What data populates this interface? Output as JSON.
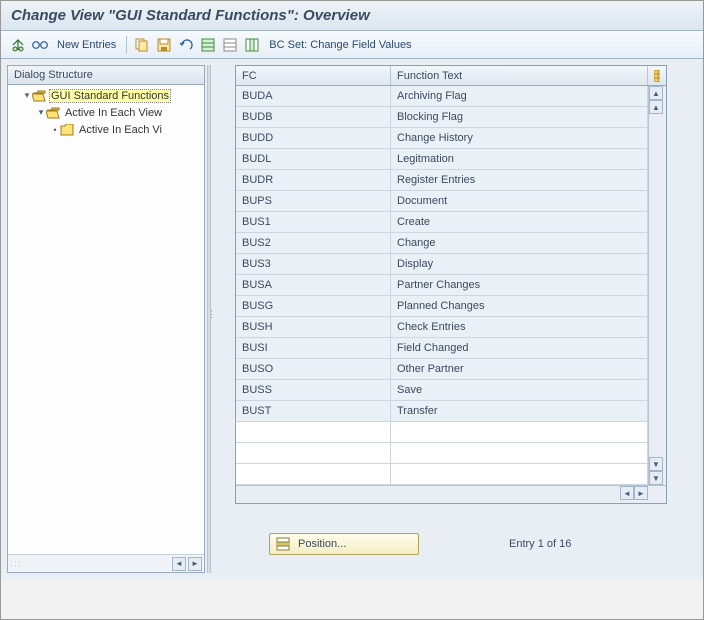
{
  "title": "Change View \"GUI Standard Functions\": Overview",
  "toolbar": {
    "new_entries": "New Entries",
    "bc_set": "BC Set: Change Field Values"
  },
  "tree": {
    "header": "Dialog Structure",
    "nodes": [
      {
        "label": "GUI Standard Functions",
        "indent": 1,
        "toggle": "▾",
        "open": true,
        "selected": true
      },
      {
        "label": "Active In Each View",
        "indent": 2,
        "toggle": "▾",
        "open": true,
        "selected": false
      },
      {
        "label": "Active In Each Vi",
        "indent": 3,
        "toggle": "•",
        "open": false,
        "selected": false
      }
    ]
  },
  "table": {
    "col_fc": "FC",
    "col_ft": "Function Text",
    "rows": [
      {
        "fc": "BUDA",
        "ft": "Archiving Flag"
      },
      {
        "fc": "BUDB",
        "ft": "Blocking Flag"
      },
      {
        "fc": "BUDD",
        "ft": "Change History"
      },
      {
        "fc": "BUDL",
        "ft": "Legitmation"
      },
      {
        "fc": "BUDR",
        "ft": "Register Entries"
      },
      {
        "fc": "BUPS",
        "ft": "Document"
      },
      {
        "fc": "BUS1",
        "ft": "Create"
      },
      {
        "fc": "BUS2",
        "ft": "Change"
      },
      {
        "fc": "BUS3",
        "ft": "Display"
      },
      {
        "fc": "BUSA",
        "ft": "Partner Changes"
      },
      {
        "fc": "BUSG",
        "ft": "Planned Changes"
      },
      {
        "fc": "BUSH",
        "ft": "Check Entries"
      },
      {
        "fc": "BUSI",
        "ft": "Field Changed"
      },
      {
        "fc": "BUSO",
        "ft": "Other Partner"
      },
      {
        "fc": "BUSS",
        "ft": "Save"
      },
      {
        "fc": "BUST",
        "ft": "Transfer"
      }
    ],
    "empty_rows": 3
  },
  "footer": {
    "position_label": "Position...",
    "entry_label": "Entry 1 of 16"
  }
}
